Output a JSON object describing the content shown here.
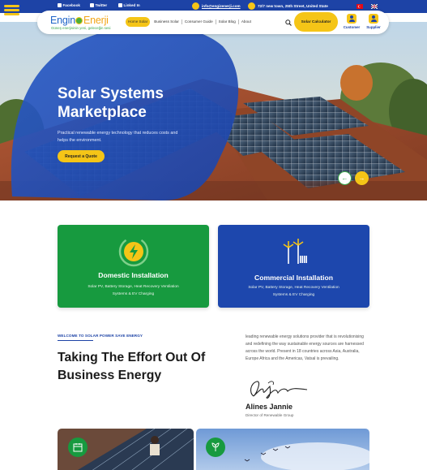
{
  "topbar": {
    "socials": [
      "Facebook",
      "Twitter",
      "Linked In"
    ],
    "email": "info@engizenerji.com",
    "address": "72/7 new town, 25th Street, United State"
  },
  "nav": {
    "logo_left": "Engin",
    "logo_right": "Enerji",
    "logo_tagline": "Güneş enerjisinin yeni, geleceğin sesi",
    "links": [
      "Home Solar",
      "Business Solar",
      "Consumer Guide",
      "Solar Blog",
      "About"
    ],
    "cta": "Solar Calculator",
    "accounts": [
      "Customer",
      "Supplier"
    ]
  },
  "hero": {
    "title_line1": "Solar Systems",
    "title_line2": "Marketplace",
    "subtitle": "Practical renewable energy technology that reduces costs and helps the environment.",
    "button": "Request a Quote",
    "prev": "←",
    "next": "→"
  },
  "cards": [
    {
      "title": "Domestic Installation",
      "text": "Solar PV, Battery Storage, Heat Recovery Ventilation Systems & EV Charging"
    },
    {
      "title": "Commercial Installation",
      "text": "Solar PV, Battery Storage, Heat Recovery Ventilation Systems & EV Charging"
    }
  ],
  "about": {
    "eyebrow": "WELCOME TO SOLAR POWER SAVE ENERGY",
    "title": "Taking The Effort Out Of Business Energy",
    "body": "leading renewable energy solutions provider that is revolutionising and redefining the way sustainable energy sources are harnessed across the world. Present in 18 countries across Asia, Australia, Europe Africa and the Americas, Vatsal is prevailing.",
    "name": "Alines Jannie",
    "role": "Director of Renewable Group"
  },
  "colors": {
    "brand_blue": "#1d43a6",
    "accent_yellow": "#f5c517",
    "brand_green": "#179a3f"
  }
}
